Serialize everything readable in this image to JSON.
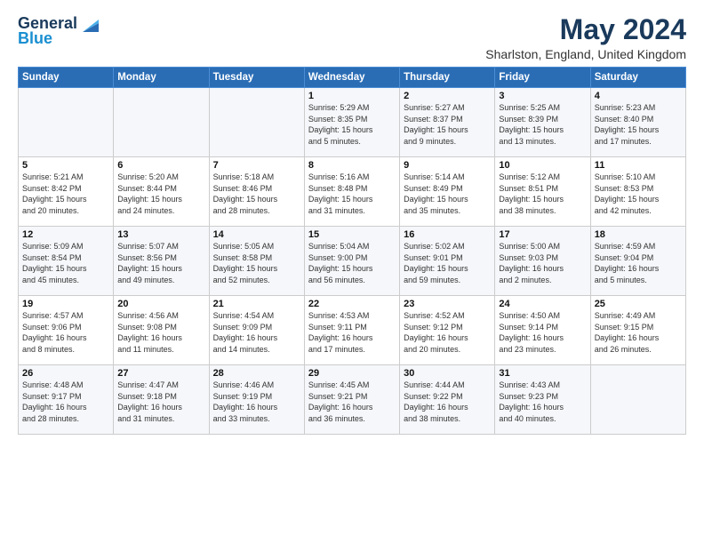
{
  "logo": {
    "general": "General",
    "blue": "Blue"
  },
  "title": {
    "month_year": "May 2024",
    "location": "Sharlston, England, United Kingdom"
  },
  "headers": [
    "Sunday",
    "Monday",
    "Tuesday",
    "Wednesday",
    "Thursday",
    "Friday",
    "Saturday"
  ],
  "weeks": [
    [
      {
        "day": "",
        "info": ""
      },
      {
        "day": "",
        "info": ""
      },
      {
        "day": "",
        "info": ""
      },
      {
        "day": "1",
        "info": "Sunrise: 5:29 AM\nSunset: 8:35 PM\nDaylight: 15 hours\nand 5 minutes."
      },
      {
        "day": "2",
        "info": "Sunrise: 5:27 AM\nSunset: 8:37 PM\nDaylight: 15 hours\nand 9 minutes."
      },
      {
        "day": "3",
        "info": "Sunrise: 5:25 AM\nSunset: 8:39 PM\nDaylight: 15 hours\nand 13 minutes."
      },
      {
        "day": "4",
        "info": "Sunrise: 5:23 AM\nSunset: 8:40 PM\nDaylight: 15 hours\nand 17 minutes."
      }
    ],
    [
      {
        "day": "5",
        "info": "Sunrise: 5:21 AM\nSunset: 8:42 PM\nDaylight: 15 hours\nand 20 minutes."
      },
      {
        "day": "6",
        "info": "Sunrise: 5:20 AM\nSunset: 8:44 PM\nDaylight: 15 hours\nand 24 minutes."
      },
      {
        "day": "7",
        "info": "Sunrise: 5:18 AM\nSunset: 8:46 PM\nDaylight: 15 hours\nand 28 minutes."
      },
      {
        "day": "8",
        "info": "Sunrise: 5:16 AM\nSunset: 8:48 PM\nDaylight: 15 hours\nand 31 minutes."
      },
      {
        "day": "9",
        "info": "Sunrise: 5:14 AM\nSunset: 8:49 PM\nDaylight: 15 hours\nand 35 minutes."
      },
      {
        "day": "10",
        "info": "Sunrise: 5:12 AM\nSunset: 8:51 PM\nDaylight: 15 hours\nand 38 minutes."
      },
      {
        "day": "11",
        "info": "Sunrise: 5:10 AM\nSunset: 8:53 PM\nDaylight: 15 hours\nand 42 minutes."
      }
    ],
    [
      {
        "day": "12",
        "info": "Sunrise: 5:09 AM\nSunset: 8:54 PM\nDaylight: 15 hours\nand 45 minutes."
      },
      {
        "day": "13",
        "info": "Sunrise: 5:07 AM\nSunset: 8:56 PM\nDaylight: 15 hours\nand 49 minutes."
      },
      {
        "day": "14",
        "info": "Sunrise: 5:05 AM\nSunset: 8:58 PM\nDaylight: 15 hours\nand 52 minutes."
      },
      {
        "day": "15",
        "info": "Sunrise: 5:04 AM\nSunset: 9:00 PM\nDaylight: 15 hours\nand 56 minutes."
      },
      {
        "day": "16",
        "info": "Sunrise: 5:02 AM\nSunset: 9:01 PM\nDaylight: 15 hours\nand 59 minutes."
      },
      {
        "day": "17",
        "info": "Sunrise: 5:00 AM\nSunset: 9:03 PM\nDaylight: 16 hours\nand 2 minutes."
      },
      {
        "day": "18",
        "info": "Sunrise: 4:59 AM\nSunset: 9:04 PM\nDaylight: 16 hours\nand 5 minutes."
      }
    ],
    [
      {
        "day": "19",
        "info": "Sunrise: 4:57 AM\nSunset: 9:06 PM\nDaylight: 16 hours\nand 8 minutes."
      },
      {
        "day": "20",
        "info": "Sunrise: 4:56 AM\nSunset: 9:08 PM\nDaylight: 16 hours\nand 11 minutes."
      },
      {
        "day": "21",
        "info": "Sunrise: 4:54 AM\nSunset: 9:09 PM\nDaylight: 16 hours\nand 14 minutes."
      },
      {
        "day": "22",
        "info": "Sunrise: 4:53 AM\nSunset: 9:11 PM\nDaylight: 16 hours\nand 17 minutes."
      },
      {
        "day": "23",
        "info": "Sunrise: 4:52 AM\nSunset: 9:12 PM\nDaylight: 16 hours\nand 20 minutes."
      },
      {
        "day": "24",
        "info": "Sunrise: 4:50 AM\nSunset: 9:14 PM\nDaylight: 16 hours\nand 23 minutes."
      },
      {
        "day": "25",
        "info": "Sunrise: 4:49 AM\nSunset: 9:15 PM\nDaylight: 16 hours\nand 26 minutes."
      }
    ],
    [
      {
        "day": "26",
        "info": "Sunrise: 4:48 AM\nSunset: 9:17 PM\nDaylight: 16 hours\nand 28 minutes."
      },
      {
        "day": "27",
        "info": "Sunrise: 4:47 AM\nSunset: 9:18 PM\nDaylight: 16 hours\nand 31 minutes."
      },
      {
        "day": "28",
        "info": "Sunrise: 4:46 AM\nSunset: 9:19 PM\nDaylight: 16 hours\nand 33 minutes."
      },
      {
        "day": "29",
        "info": "Sunrise: 4:45 AM\nSunset: 9:21 PM\nDaylight: 16 hours\nand 36 minutes."
      },
      {
        "day": "30",
        "info": "Sunrise: 4:44 AM\nSunset: 9:22 PM\nDaylight: 16 hours\nand 38 minutes."
      },
      {
        "day": "31",
        "info": "Sunrise: 4:43 AM\nSunset: 9:23 PM\nDaylight: 16 hours\nand 40 minutes."
      },
      {
        "day": "",
        "info": ""
      }
    ]
  ]
}
